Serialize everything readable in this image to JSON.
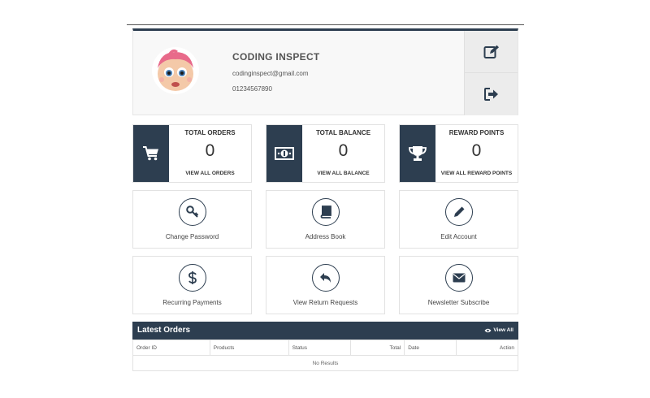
{
  "profile": {
    "name": "CODING INSPECT",
    "email": "codinginspect@gmail.com",
    "phone": "01234567890"
  },
  "stats": [
    {
      "title": "TOTAL ORDERS",
      "value": "0",
      "link": "VIEW ALL ORDERS",
      "icon": "cart-icon"
    },
    {
      "title": "TOTAL BALANCE",
      "value": "0",
      "link": "VIEW ALL BALANCE",
      "icon": "money-icon"
    },
    {
      "title": "REWARD POINTS",
      "value": "0",
      "link": "VIEW ALL REWARD POINTS",
      "icon": "trophy-icon"
    }
  ],
  "tiles": [
    {
      "label": "Change Password",
      "icon": "key-icon"
    },
    {
      "label": "Address Book",
      "icon": "book-icon"
    },
    {
      "label": "Edit Account",
      "icon": "pencil-icon"
    },
    {
      "label": "Recurring Payments",
      "icon": "dollar-icon"
    },
    {
      "label": "View Return Requests",
      "icon": "reply-icon"
    },
    {
      "label": "Newsletter Subscribe",
      "icon": "envelope-icon"
    }
  ],
  "orders": {
    "title": "Latest Orders",
    "view_all": "View All",
    "columns": [
      "Order ID",
      "Products",
      "Status",
      "Total",
      "Date",
      "Action"
    ],
    "empty": "No Results"
  },
  "colors": {
    "accent": "#2d3e50",
    "panel": "#f8f8f8"
  }
}
